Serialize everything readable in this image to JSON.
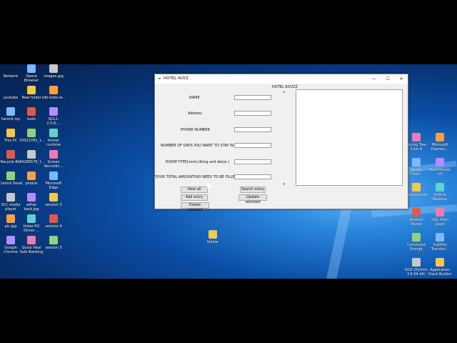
{
  "desktop_icons": {
    "col1": [
      "Network",
      "youtube",
      "harshit.roy",
      "This PC",
      "Recycle Bin",
      "Control Panel",
      "VLC media player",
      "pic.jpg",
      "Google Chrome"
    ],
    "col2": [
      "Opera Browser",
      "New folder",
      "tools",
      "33022781_1...",
      "34286579_1...",
      "photos",
      "adhar back.jpg",
      "tinker.PO Driver ...",
      "Quick Heal Safe Banking"
    ],
    "col3": [
      "images.jpg",
      "sdk-tools-w...",
      "SDL2-2.0.8-...",
      "tkinter runtime",
      "Screen Recordin...",
      "Microsoft Edge",
      "session 3",
      "session 4",
      "session 5"
    ],
    "right1": [
      "Spring Tree Cam 8",
      "Adobe Creati...",
      "WampServer",
      "Android Studio",
      "Command Prompt",
      "IDLE (Python 3.6 64-bit)"
    ],
    "right2": [
      "Microsoft Express...",
      "TeamViewer 13",
      "GitHub Desktop",
      "SQL Shell (psql)",
      "Subtitle Translat...",
      "Application Stack Builder"
    ],
    "center_folder": "tkinter"
  },
  "window": {
    "title": "HOTEL ROYZ",
    "controls": {
      "minimize": "—",
      "maximize": "☐",
      "close": "✕"
    },
    "heading": "HOTEL ROVZZ",
    "fields": [
      {
        "label": "NAME",
        "value": ""
      },
      {
        "label": "Address",
        "value": ""
      },
      {
        "label": "PHONE NUMBER",
        "value": ""
      },
      {
        "label": "NUMBER OF DAYS YOU WANT TO STAY IN",
        "value": ""
      },
      {
        "label": "ROOM TYPE(norm,liking and delux )",
        "value": ""
      },
      {
        "label": "YOUR TOTAL AMOUNT(NO NEED TO BE FILLED)",
        "value": ""
      }
    ],
    "buttons": {
      "view_all": "View all",
      "add_entry": "Add entry",
      "delete_selected": "Delete selected",
      "search_entry": "Search entry",
      "update_selected": "Update selected"
    }
  }
}
